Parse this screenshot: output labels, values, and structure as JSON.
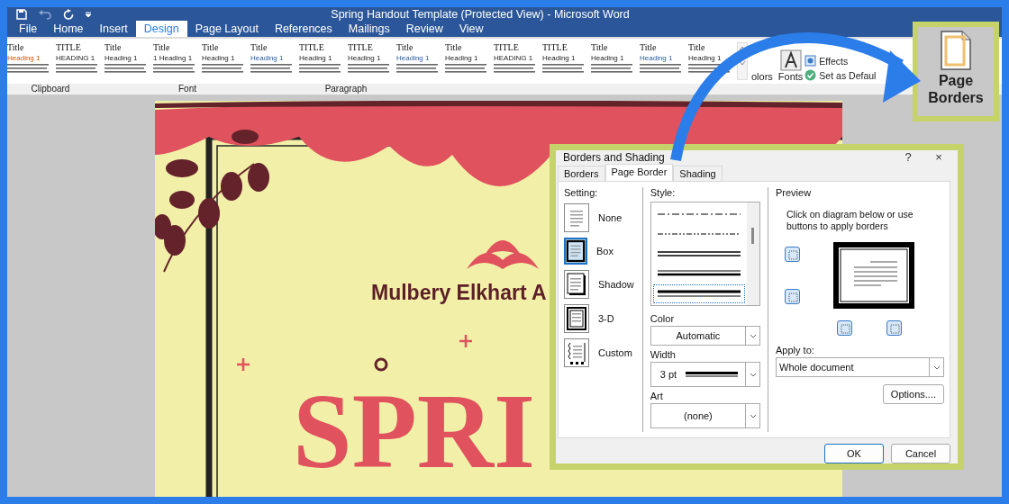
{
  "window": {
    "title": "Spring Handout Template (Protected View) - Microsoft Word"
  },
  "tabs": [
    {
      "label": "File",
      "selected": false
    },
    {
      "label": "Home",
      "selected": false
    },
    {
      "label": "Insert",
      "selected": false
    },
    {
      "label": "Design",
      "selected": true
    },
    {
      "label": "Page Layout",
      "selected": false
    },
    {
      "label": "References",
      "selected": false
    },
    {
      "label": "Mailings",
      "selected": false
    },
    {
      "label": "Review",
      "selected": false
    },
    {
      "label": "View",
      "selected": false
    }
  ],
  "style_gallery": [
    {
      "title": "Title",
      "heading": "Heading 1"
    },
    {
      "title": "TITLE",
      "heading": "HEADING 1"
    },
    {
      "title": "Title",
      "heading": "Heading 1"
    },
    {
      "title": "Title",
      "heading": "1 Heading 1"
    },
    {
      "title": "Title",
      "heading": "Heading 1"
    },
    {
      "title": "Title",
      "heading": "Heading 1"
    },
    {
      "title": "TITLE",
      "heading": "Heading 1"
    },
    {
      "title": "TITLE",
      "heading": "Heading 1"
    },
    {
      "title": "Title",
      "heading": "Heading 1"
    },
    {
      "title": "Title",
      "heading": "Heading 1"
    },
    {
      "title": "TITLE",
      "heading": "HEADING 1"
    },
    {
      "title": "TITLE",
      "heading": "Heading 1"
    },
    {
      "title": "Title",
      "heading": "Heading 1"
    },
    {
      "title": "Title",
      "heading": "Heading 1"
    },
    {
      "title": "Title",
      "heading": "Heading 1"
    }
  ],
  "design_buttons": [
    {
      "label": "olors"
    },
    {
      "label": "Fonts"
    }
  ],
  "design_options": [
    {
      "label": "Effects",
      "kind": "effects"
    },
    {
      "label": "Set as Defaul",
      "kind": "default"
    }
  ],
  "group_labels": [
    "Clipboard",
    "Font",
    "Paragraph"
  ],
  "document": {
    "organization": "Mulbery Elkhart A",
    "headline": "SPRI"
  },
  "callout": {
    "label": "Page Borders"
  },
  "dialog": {
    "title": "Borders and Shading",
    "help": "?",
    "close": "×",
    "tabs": [
      {
        "label": "Borders",
        "selected": false
      },
      {
        "label": "Page Border",
        "selected": true
      },
      {
        "label": "Shading",
        "selected": false
      }
    ],
    "setting_label": "Setting:",
    "settings": [
      {
        "label": "None",
        "kind": "none",
        "selected": false
      },
      {
        "label": "Box",
        "kind": "box",
        "selected": true
      },
      {
        "label": "Shadow",
        "kind": "shadow",
        "selected": false
      },
      {
        "label": "3-D",
        "kind": "threed",
        "selected": false
      },
      {
        "label": "Custom",
        "kind": "custom",
        "selected": false
      }
    ],
    "style_label": "Style:",
    "styles": [
      {
        "kind": "dash-dot",
        "selected": false
      },
      {
        "kind": "dash-dot-dot",
        "selected": false
      },
      {
        "kind": "double",
        "selected": false
      },
      {
        "kind": "thin-thick",
        "selected": false
      },
      {
        "kind": "thick-thin",
        "selected": true
      }
    ],
    "color_label": "Color",
    "color_value": "Automatic",
    "width_label": "Width",
    "width_value": "3 pt",
    "art_label": "Art",
    "art_value": "(none)",
    "preview_label": "Preview",
    "preview_hint": "Click on diagram below or use buttons to apply borders",
    "apply_label": "Apply to:",
    "apply_value": "Whole document",
    "options_button": "Options....",
    "ok_button": "OK",
    "cancel_button": "Cancel"
  }
}
